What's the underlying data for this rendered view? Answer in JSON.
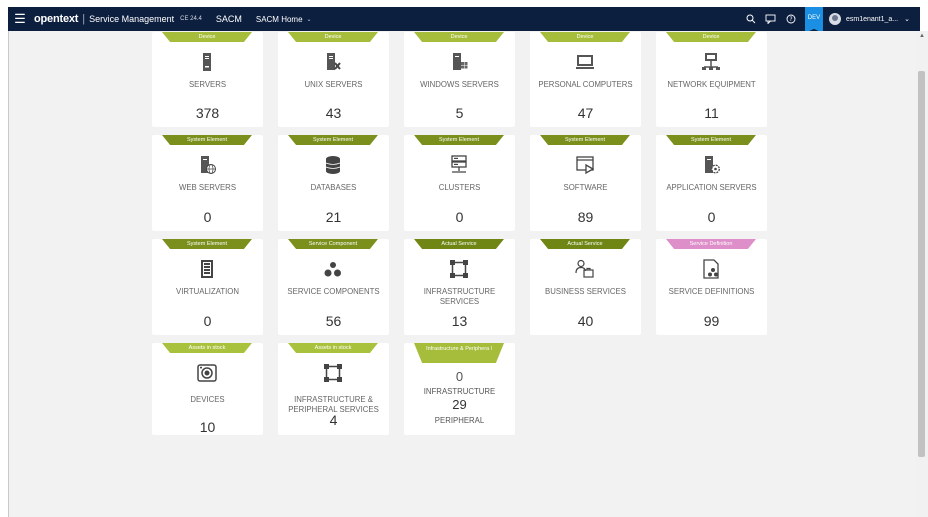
{
  "header": {
    "menu_icon": "hamburger-icon",
    "brand": "opentext",
    "divider": "|",
    "product": "Service Management",
    "version": "CE 24.4",
    "app": "SACM",
    "home": "SACM Home",
    "env_badge": "DEV",
    "user": "esm1enant1_a...",
    "icons": [
      "search-icon",
      "chat-icon",
      "help-icon",
      "chevron-down-icon"
    ]
  },
  "cards": [
    {
      "tag": "Device",
      "label": "SERVERS",
      "count": "378",
      "icon": "server-icon"
    },
    {
      "tag": "Device",
      "label": "UNIX SERVERS",
      "count": "43",
      "icon": "unix-server-icon"
    },
    {
      "tag": "Device",
      "label": "WINDOWS SERVERS",
      "count": "5",
      "icon": "windows-server-icon"
    },
    {
      "tag": "Device",
      "label": "PERSONAL COMPUTERS",
      "count": "47",
      "icon": "monitor-icon"
    },
    {
      "tag": "Device",
      "label": "NETWORK EQUIPMENT",
      "count": "11",
      "icon": "network-icon"
    },
    {
      "tag": "System Element",
      "label": "WEB SERVERS",
      "count": "0",
      "icon": "web-server-icon"
    },
    {
      "tag": "System Element",
      "label": "DATABASES",
      "count": "21",
      "icon": "database-icon"
    },
    {
      "tag": "System Element",
      "label": "CLUSTERS",
      "count": "0",
      "icon": "cluster-icon"
    },
    {
      "tag": "System Element",
      "label": "SOFTWARE",
      "count": "89",
      "icon": "software-icon"
    },
    {
      "tag": "System Element",
      "label": "APPLICATION SERVERS",
      "count": "0",
      "icon": "application-server-icon"
    },
    {
      "tag": "System Element",
      "label": "VIRTUALIZATION",
      "count": "0",
      "icon": "virtualization-icon"
    },
    {
      "tag": "Service Component",
      "label": "SERVICE COMPONENTS",
      "count": "56",
      "icon": "service-component-icon"
    },
    {
      "tag": "Actual Service",
      "label": "INFRASTRUCTURE SERVICES",
      "count": "13",
      "icon": "infrastructure-icon"
    },
    {
      "tag": "Actual Service",
      "label": "BUSINESS SERVICES",
      "count": "40",
      "icon": "business-services-icon"
    },
    {
      "tag": "Service Definition",
      "label": "SERVICE DEFINITIONS",
      "count": "99",
      "icon": "service-definition-icon"
    },
    {
      "tag": "Assets in stock",
      "label": "DEVICES",
      "count": "10",
      "icon": "devices-icon"
    },
    {
      "tag": "Assets in stock",
      "label": "INFRASTRUCTURE & PERIPHERAL SERVICES",
      "count": "4",
      "icon": "infrastructure-peripheral-icon"
    }
  ],
  "partial_card": {
    "tag": "Infrastructure & Periphera l",
    "zero": "0",
    "label": "INFRASTRUCTURE",
    "count": "29",
    "sub": "PERIPHERAL"
  }
}
